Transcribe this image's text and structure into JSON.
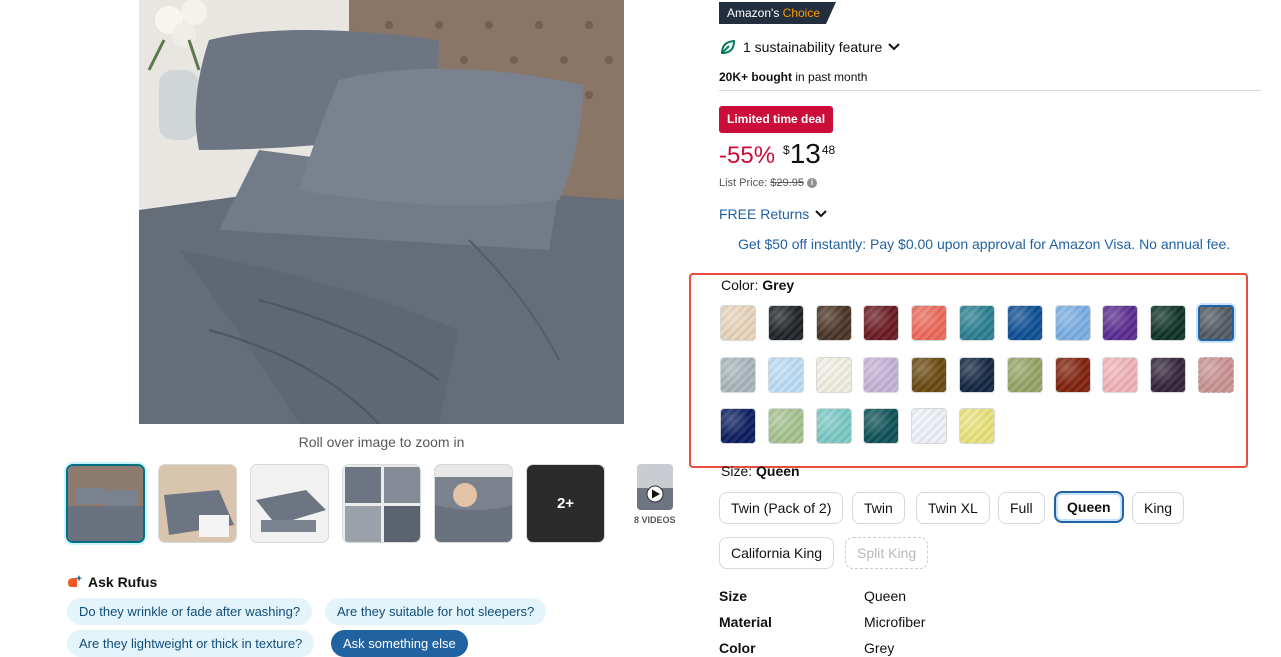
{
  "gallery": {
    "zoom_hint": "Roll over image to zoom in",
    "more_thumbs_label": "2+",
    "videos_label": "8 VIDEOS"
  },
  "rufus": {
    "title": "Ask Rufus",
    "questions": [
      "Do they wrinkle or fade after washing?",
      "Are they suitable for hot sleepers?",
      "Are they lightweight or thick in texture?"
    ],
    "ask_else": "Ask something else"
  },
  "product": {
    "badge_prefix": "Amazon's",
    "badge_choice": "Choice",
    "sustainability": "1 sustainability feature",
    "bought_count": "20K+ bought",
    "bought_suffix": "in past month",
    "deal_label": "Limited time deal",
    "discount": "-55%",
    "currency": "$",
    "price_whole": "13",
    "price_fraction": "48",
    "list_price_label": "List Price:",
    "list_price": "$29.95",
    "returns": "FREE Returns",
    "promo": "Get $50 off instantly: Pay $0.00 upon approval for Amazon Visa. No annual fee."
  },
  "color": {
    "label": "Color:",
    "selected": "Grey",
    "swatches": [
      "#e8d5bb",
      "#1f2226",
      "#4a3326",
      "#6b1a22",
      "#ec6a5b",
      "#2a7f91",
      "#0e4f94",
      "#7aaee3",
      "#5b2c91",
      "#0f3326",
      "#545a63",
      "#a9b6bd",
      "#bcdcf5",
      "#f1efe2",
      "#c6b2d6",
      "#6a4a12",
      "#132642",
      "#96a466",
      "#7f220d",
      "#f0b3b9",
      "#33243a",
      "#c99392",
      "#0c1f60",
      "#a6c28f",
      "#7cc9c5",
      "#0f5358",
      "#eef0f6",
      "#e9e27c"
    ]
  },
  "size": {
    "label": "Size:",
    "selected": "Queen",
    "options": [
      "Twin (Pack of 2)",
      "Twin",
      "Twin XL",
      "Full",
      "Queen",
      "King",
      "California King",
      "Split King"
    ]
  },
  "specs": [
    {
      "key": "Size",
      "value": "Queen"
    },
    {
      "key": "Material",
      "value": "Microfiber"
    },
    {
      "key": "Color",
      "value": "Grey"
    }
  ]
}
